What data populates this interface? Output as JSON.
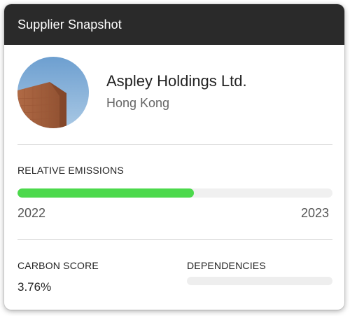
{
  "header": {
    "title": "Supplier Snapshot"
  },
  "supplier": {
    "name": "Aspley Holdings Ltd.",
    "location": "Hong Kong",
    "avatar_icon": "building-photo"
  },
  "emissions": {
    "label": "RELATIVE EMISSIONS",
    "progress": 0.56,
    "start_year": "2022",
    "end_year": "2023",
    "bar_color": "#4cd94c"
  },
  "carbon": {
    "label": "CARBON SCORE",
    "value": "3.76%"
  },
  "dependencies": {
    "label": "DEPENDENCIES"
  },
  "colors": {
    "header_bg": "#2a2a2a",
    "accent": "#4cd94c",
    "track": "#f0f0f0"
  }
}
